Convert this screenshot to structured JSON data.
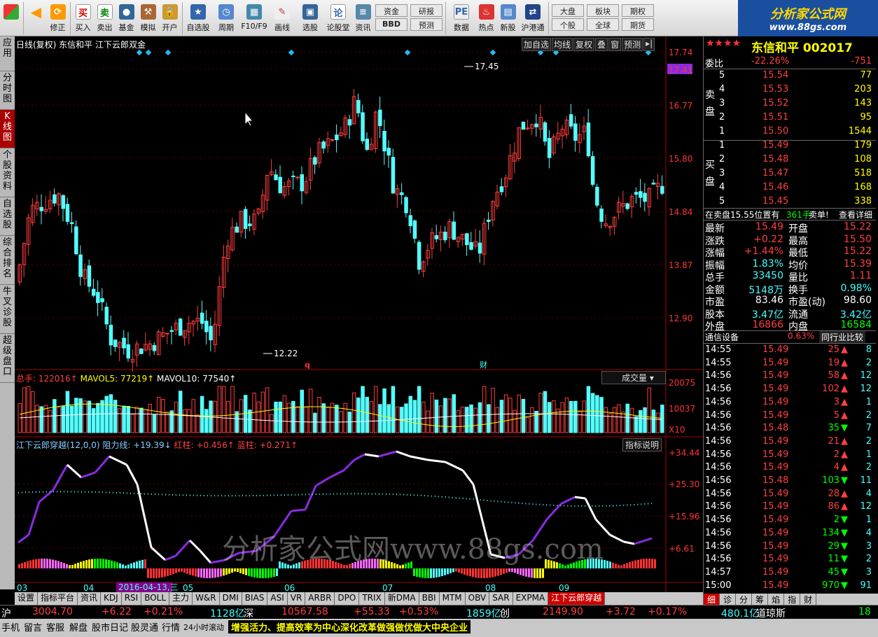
{
  "toolbar": {
    "items": [
      "修正",
      "买入",
      "卖出",
      "基金",
      "模拟",
      "开户",
      "自选股",
      "周期",
      "F10/F9",
      "画线",
      "选股",
      "论股堂",
      "资讯",
      "BBD",
      "数据",
      "热点",
      "新股",
      "沪港通"
    ],
    "small": [
      "资金",
      "研报",
      "预测",
      "大盘",
      "板块",
      "期权",
      "个股",
      "全球",
      "期货"
    ]
  },
  "logo": {
    "title": "分析家公式网",
    "url": "www.88gs.com"
  },
  "leftnav": [
    "应用",
    "分时图",
    "K线图",
    "个股资料",
    "自选股",
    "综合排名",
    "牛叉诊股",
    "超级盘口"
  ],
  "chart": {
    "header": "日线(复权)  东信和平  江下云郎双金",
    "buttons": [
      "加自选",
      "均线",
      "复权",
      "叠",
      "窗",
      "预测"
    ],
    "price_ticks": [
      "17.74",
      "17.41",
      "16.77",
      "15.80",
      "14.84",
      "13.87",
      "12.90"
    ],
    "high_label": "17.45",
    "low_label": "12.22",
    "vol_header": {
      "total": "总手: 122016↑",
      "ma5": "MAVOL5: 77219↑",
      "ma10": "MAVOL10: 77540↑"
    },
    "vol_btn": "成交量",
    "vol_ticks": [
      "20075",
      "10037",
      "X10"
    ],
    "ind_header": {
      "name": "江下云郎穿越(12,0,0)",
      "r": "阻力线: +19.39↓",
      "red": "红柱: +0.456↑",
      "blue": "蓝柱: +0.271↑"
    },
    "ind_btn": "指标说明",
    "ind_ticks": [
      "+34.44",
      "+25.30",
      "+15.96",
      "+6.61"
    ],
    "months": [
      "03",
      "04",
      "05",
      "06",
      "07",
      "08",
      "09"
    ],
    "date_label": "2016-04-13,三",
    "marks": [
      "q",
      "财"
    ],
    "watermark": "分析家公式网www.88gs.com"
  },
  "chart_data": {
    "type": "candlestick",
    "title": "东信和平 002017 日线",
    "ylim": [
      12.22,
      17.74
    ],
    "high": 17.45,
    "low": 12.22
  },
  "tabs": [
    "设置",
    "指标平台",
    "资讯",
    "KDJ",
    "RSI",
    "BOLL",
    "主力",
    "W&R",
    "DMI",
    "BIAS",
    "ASI",
    "VR",
    "ARBR",
    "DPO",
    "TRIX",
    "新DMA",
    "BBI",
    "MTM",
    "OBV",
    "SAR",
    "EXPMA",
    "江下云郎穿越"
  ],
  "right": {
    "title": "东信和平  002017",
    "weibi": [
      "委比",
      "-22.26%",
      "-751"
    ],
    "sell": [
      [
        "5",
        "15.54",
        "77"
      ],
      [
        "4",
        "15.53",
        "203"
      ],
      [
        "3",
        "15.52",
        "143"
      ],
      [
        "2",
        "15.51",
        "95"
      ],
      [
        "1",
        "15.50",
        "1544"
      ]
    ],
    "buy": [
      [
        "1",
        "15.49",
        "179"
      ],
      [
        "2",
        "15.48",
        "108"
      ],
      [
        "3",
        "15.47",
        "518"
      ],
      [
        "4",
        "15.46",
        "168"
      ],
      [
        "5",
        "15.45",
        "338"
      ]
    ],
    "sell_label": "卖盘",
    "buy_label": "买盘",
    "notice": [
      "在卖盘15.55位置有",
      "361手",
      "卖单!",
      "查看详细"
    ],
    "stats": [
      [
        "最新",
        "15.49",
        "开盘",
        "15.22"
      ],
      [
        "涨跌",
        "+0.22",
        "最高",
        "15.50"
      ],
      [
        "涨幅",
        "+1.44%",
        "最低",
        "15.22"
      ],
      [
        "振幅",
        "1.83%",
        "均价",
        "15.39"
      ],
      [
        "总手",
        "33450",
        "量比",
        "1.11"
      ],
      [
        "金额",
        "5148万",
        "换手",
        "0.98%"
      ],
      [
        "市盈",
        "83.46",
        "市盈(动)",
        "98.60"
      ],
      [
        "股本",
        "3.47亿",
        "流通",
        "3.42亿"
      ],
      [
        "外盘",
        "16866",
        "内盘",
        "16584"
      ]
    ],
    "sector": [
      "通信设备",
      "0.63%",
      "同行业比较"
    ],
    "ticks": [
      [
        "14:55",
        "15.49",
        "25",
        "8",
        "u"
      ],
      [
        "14:55",
        "15.49",
        "19",
        "2",
        "u"
      ],
      [
        "14:56",
        "15.49",
        "58",
        "12",
        "u"
      ],
      [
        "14:56",
        "15.49",
        "102",
        "12",
        "u"
      ],
      [
        "14:56",
        "15.49",
        "3",
        "1",
        "u"
      ],
      [
        "14:56",
        "15.49",
        "5",
        "2",
        "u"
      ],
      [
        "14:56",
        "15.48",
        "35",
        "7",
        "d"
      ],
      [
        "14:56",
        "15.49",
        "21",
        "2",
        "u"
      ],
      [
        "14:56",
        "15.49",
        "2",
        "1",
        "u"
      ],
      [
        "14:56",
        "15.49",
        "4",
        "2",
        "u"
      ],
      [
        "14:56",
        "15.48",
        "103",
        "11",
        "d"
      ],
      [
        "14:56",
        "15.49",
        "28",
        "4",
        "u"
      ],
      [
        "14:56",
        "15.49",
        "86",
        "12",
        "u"
      ],
      [
        "14:56",
        "15.49",
        "2",
        "1",
        "d"
      ],
      [
        "14:56",
        "15.49",
        "134",
        "4",
        "d"
      ],
      [
        "14:56",
        "15.49",
        "29",
        "3",
        "d"
      ],
      [
        "14:56",
        "15.49",
        "11",
        "2",
        "d"
      ],
      [
        "14:57",
        "15.49",
        "45",
        "3",
        "d"
      ],
      [
        "15:00",
        "15.49",
        "970",
        "91",
        "d"
      ]
    ],
    "bottom_tabs": [
      "细",
      "诊",
      "分",
      "筹",
      "焰",
      "指",
      "财"
    ]
  },
  "status": {
    "sh": [
      "沪",
      "3004.70",
      "+6.22",
      "+0.21%",
      "1128亿"
    ],
    "sz": [
      "深",
      "10567.58",
      "+55.33",
      "+0.53%",
      "1859亿"
    ],
    "cy": [
      "创",
      "2149.90",
      "+3.72",
      "+0.17%",
      "480.1亿"
    ],
    "dq": [
      "道琼斯",
      "18"
    ],
    "links": [
      "手机",
      "留言",
      "客服",
      "解盘",
      "股市日记",
      "股灵通",
      "行情",
      "24小时滚动"
    ],
    "news": "增强活力、提高效率为中心深化改革做强做优做大中央企业"
  }
}
